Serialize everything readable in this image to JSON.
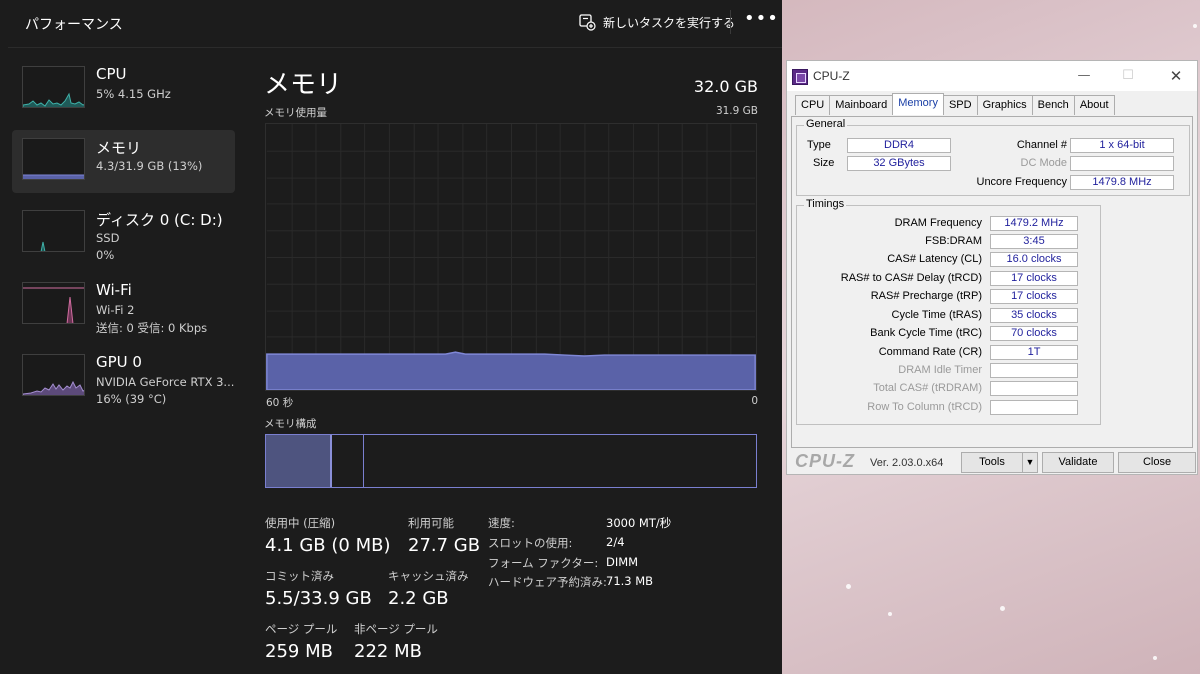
{
  "taskmanager": {
    "title": "パフォーマンス",
    "new_task_label": "新しいタスクを実行する",
    "more_label": "•••",
    "sidebar": [
      {
        "name": "CPU",
        "line1": "5% 4.15 GHz",
        "line2": ""
      },
      {
        "name": "メモリ",
        "line1": "4.3/31.9 GB (13%)",
        "line2": ""
      },
      {
        "name": "ディスク 0 (C: D:)",
        "line1": "SSD",
        "line2": "0%"
      },
      {
        "name": "Wi-Fi",
        "line1": "Wi-Fi 2",
        "line2": "送信: 0 受信: 0 Kbps"
      },
      {
        "name": "GPU 0",
        "line1": "NVIDIA GeForce RTX 3...",
        "line2": "16% (39 °C)"
      }
    ],
    "memory": {
      "title": "メモリ",
      "total": "32.0 GB",
      "usage_label": "メモリ使用量",
      "usage_max": "31.9 GB",
      "axis_left": "60 秒",
      "axis_right": "0",
      "usage_fraction": 0.135,
      "composition_label": "メモリ構成",
      "composition_in_use_fraction": 0.135,
      "composition_modified_fraction": 0.065,
      "stats": {
        "in_use_label": "使用中 (圧縮)",
        "in_use_value": "4.1 GB (0 MB)",
        "available_label": "利用可能",
        "available_value": "27.7 GB",
        "committed_label": "コミット済み",
        "committed_value": "5.5/33.9 GB",
        "cached_label": "キャッシュ済み",
        "cached_value": "2.2 GB",
        "paged_label": "ページ プール",
        "paged_value": "259 MB",
        "nonpaged_label": "非ページ プール",
        "nonpaged_value": "222 MB"
      },
      "specs": [
        {
          "label": "速度:",
          "value": "3000 MT/秒"
        },
        {
          "label": "スロットの使用:",
          "value": "2/4"
        },
        {
          "label": "フォーム ファクター:",
          "value": "DIMM"
        },
        {
          "label": "ハードウェア予約済み:",
          "value": "71.3 MB"
        }
      ]
    },
    "colors": {
      "memory_fill": "#5a62a8",
      "memory_line": "#7f87d6",
      "wifi": "#d16da0",
      "cpu": "#3fb0a8"
    }
  },
  "cpuz": {
    "title": "CPU-Z",
    "tabs": [
      "CPU",
      "Mainboard",
      "Memory",
      "SPD",
      "Graphics",
      "Bench",
      "About"
    ],
    "active_tab": "Memory",
    "general": {
      "title": "General",
      "type_label": "Type",
      "type_value": "DDR4",
      "size_label": "Size",
      "size_value": "32 GBytes",
      "channel_label": "Channel #",
      "channel_value": "1 x 64-bit",
      "dc_mode_label": "DC Mode",
      "dc_mode_value": "",
      "uncore_label": "Uncore Frequency",
      "uncore_value": "1479.8 MHz"
    },
    "timings": {
      "title": "Timings",
      "rows": [
        {
          "label": "DRAM Frequency",
          "value": "1479.2 MHz",
          "dim": false
        },
        {
          "label": "FSB:DRAM",
          "value": "3:45",
          "dim": false
        },
        {
          "label": "CAS# Latency (CL)",
          "value": "16.0 clocks",
          "dim": false
        },
        {
          "label": "RAS# to CAS# Delay (tRCD)",
          "value": "17 clocks",
          "dim": false
        },
        {
          "label": "RAS# Precharge (tRP)",
          "value": "17 clocks",
          "dim": false
        },
        {
          "label": "Cycle Time (tRAS)",
          "value": "35 clocks",
          "dim": false
        },
        {
          "label": "Bank Cycle Time (tRC)",
          "value": "70 clocks",
          "dim": false
        },
        {
          "label": "Command Rate (CR)",
          "value": "1T",
          "dim": false
        },
        {
          "label": "DRAM Idle Timer",
          "value": "",
          "dim": true
        },
        {
          "label": "Total CAS# (tRDRAM)",
          "value": "",
          "dim": true
        },
        {
          "label": "Row To Column (tRCD)",
          "value": "",
          "dim": true
        }
      ]
    },
    "footer": {
      "logo": "CPU-Z",
      "version": "Ver. 2.03.0.x64",
      "tools_label": "Tools",
      "validate_label": "Validate",
      "close_label": "Close"
    }
  }
}
